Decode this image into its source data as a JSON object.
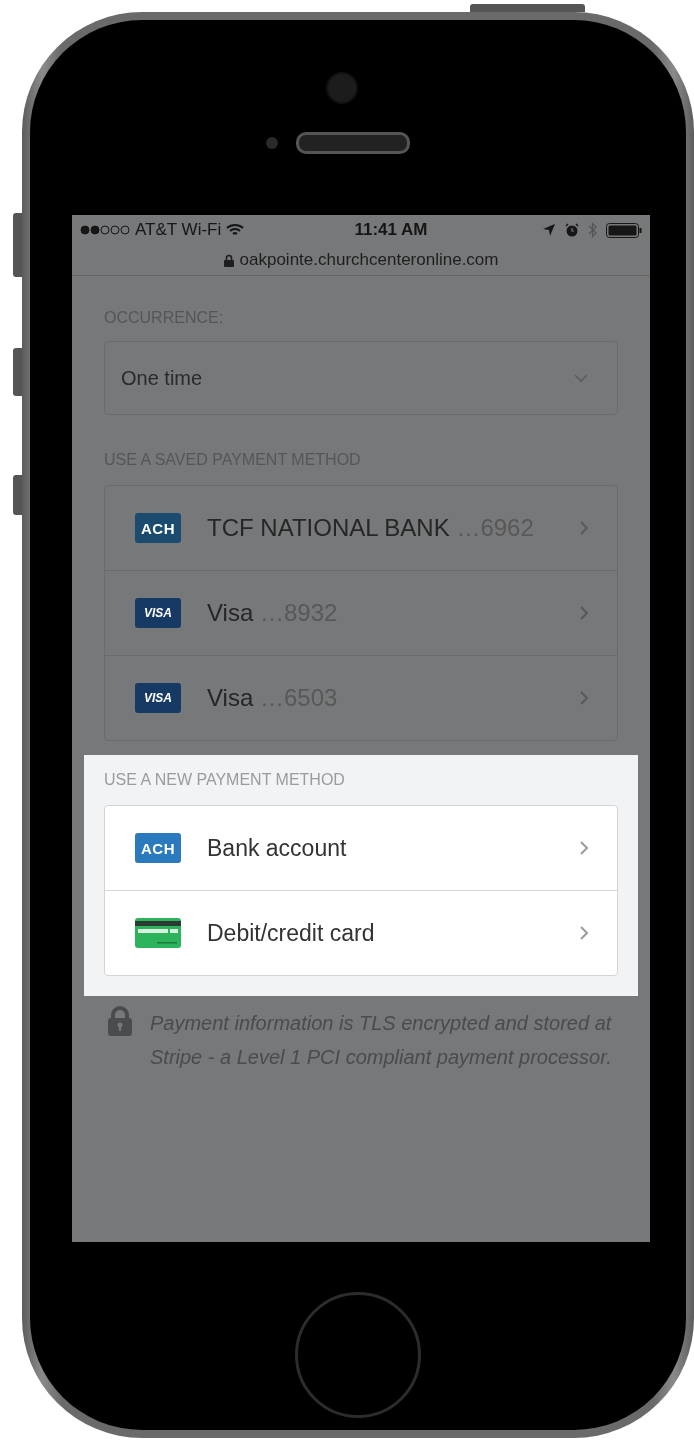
{
  "status_bar": {
    "carrier": "AT&T Wi-Fi",
    "time": "11:41 AM"
  },
  "address_bar": {
    "url": "oakpointe.churchcenteronline.com"
  },
  "occurrence": {
    "label": "OCCURRENCE:",
    "value": "One time"
  },
  "saved_methods": {
    "label": "USE A SAVED PAYMENT METHOD",
    "items": [
      {
        "kind": "ach",
        "badge": "ACH",
        "name": "TCF NATIONAL BANK",
        "last4": "…6962"
      },
      {
        "kind": "visa",
        "badge": "VISA",
        "name": "Visa",
        "last4": "…8932"
      },
      {
        "kind": "visa",
        "badge": "VISA",
        "name": "Visa",
        "last4": "…6503"
      }
    ]
  },
  "new_methods": {
    "label": "USE A NEW PAYMENT METHOD",
    "items": [
      {
        "kind": "ach",
        "badge": "ACH",
        "name": "Bank account"
      },
      {
        "kind": "card",
        "name": "Debit/credit card"
      }
    ]
  },
  "security_note": "Payment information is TLS encrypted and stored at Stripe - a Level 1 PCI compliant payment processor."
}
